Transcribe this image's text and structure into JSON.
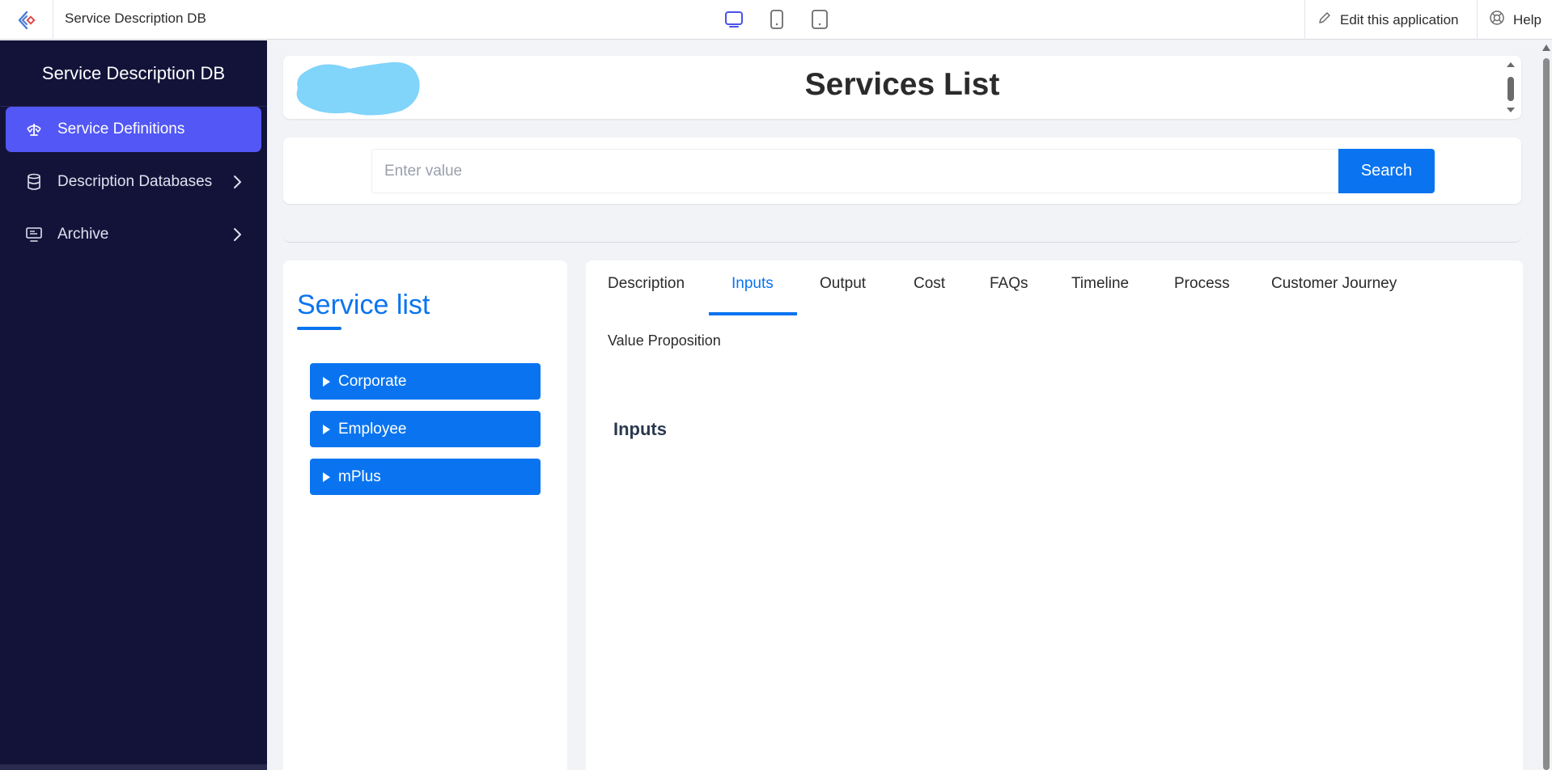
{
  "topbar": {
    "app_title": "Service Description DB",
    "edit_label": "Edit this application",
    "help_label": "Help",
    "devices": [
      "desktop-icon",
      "phone-icon",
      "tablet-icon"
    ]
  },
  "sidebar": {
    "title": "Service Description DB",
    "items": [
      {
        "label": "Service Definitions",
        "icon": "balance-scale-icon",
        "active": true
      },
      {
        "label": "Description Databases",
        "icon": "database-icon",
        "active": false
      },
      {
        "label": "Archive",
        "icon": "monitor-icon",
        "active": false
      }
    ]
  },
  "header": {
    "title": "Services List"
  },
  "search": {
    "placeholder": "Enter value",
    "value": "",
    "button_label": "Search"
  },
  "service_list": {
    "title": "Service list",
    "categories": [
      "Corporate",
      "Employee",
      "mPlus"
    ]
  },
  "detail": {
    "tabs": [
      "Description",
      "Inputs",
      "Output",
      "Cost",
      "FAQs",
      "Timeline",
      "Process",
      "Customer Journey"
    ],
    "active_tab": "Inputs",
    "value_proposition_label": "Value Proposition",
    "section_heading": "Inputs"
  },
  "colors": {
    "accent": "#0a74f0",
    "sidebar_bg": "#13133a",
    "sidebar_active": "#5257f5"
  }
}
